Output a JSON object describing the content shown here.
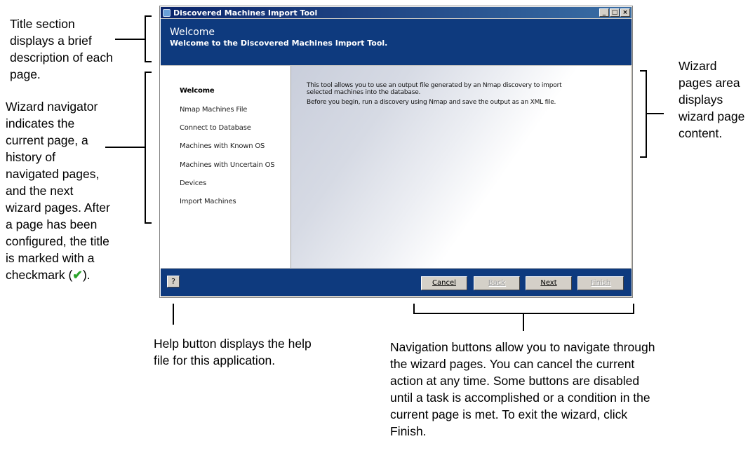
{
  "window": {
    "title": "Discovered Machines Import Tool",
    "controls": {
      "minimize": "_",
      "maximize": "□",
      "close": "×"
    }
  },
  "header": {
    "title": "Welcome",
    "subtitle": "Welcome to the Discovered Machines Import Tool."
  },
  "navigator": {
    "items": [
      {
        "label": "Welcome",
        "current": true
      },
      {
        "label": "Nmap Machines File",
        "current": false
      },
      {
        "label": "Connect to Database",
        "current": false
      },
      {
        "label": "Machines with Known OS",
        "current": false
      },
      {
        "label": "Machines with Uncertain OS",
        "current": false
      },
      {
        "label": "Devices",
        "current": false
      },
      {
        "label": "Import Machines",
        "current": false
      }
    ]
  },
  "content": {
    "paragraph1": "This tool allows you to use an output file generated by an Nmap discovery to import selected machines into the database.",
    "paragraph2": "Before you begin, run a discovery using Nmap and save the output as an XML file."
  },
  "footer": {
    "help_label": "?",
    "cancel_label": "Cancel",
    "back_label": "Back",
    "next_label": "Next",
    "finish_label": "Finish",
    "back_enabled": false,
    "finish_enabled": false
  },
  "callouts": {
    "title_section": "Title section displays a brief description of each page.",
    "navigator": "Wizard navigator indicates the current page, a history of navigated pages, and the next wizard pages. After a page has been configured, the title is marked with a checkmark (",
    "navigator_end": ").",
    "checkmark_glyph": "✔",
    "pages_area": "Wizard pages area displays wizard page content.",
    "help": "Help button displays the help file for this application.",
    "nav_buttons": "Navigation buttons allow you to navigate through the wizard pages. You can cancel the current action at any time. Some buttons are disabled until a task is accomplished or a condition in the current page is met. To exit the wizard, click Finish."
  },
  "colors": {
    "header_bg": "#0e3a7e",
    "titlebar_start": "#0a246a",
    "check_green": "#2aa32a"
  }
}
